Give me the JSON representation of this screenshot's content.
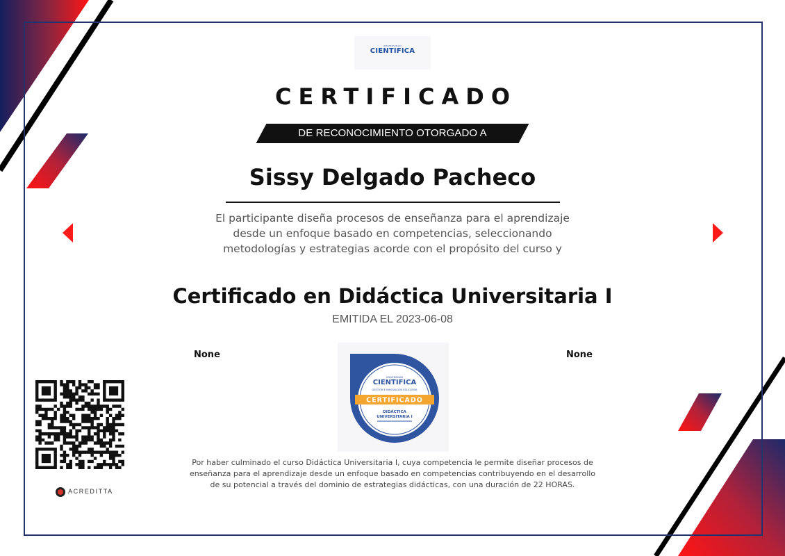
{
  "certificate": {
    "institution_logo": {
      "small_text": "UNIVERSIDAD",
      "name": "CIENTIFICA"
    },
    "title": "CERTIFICADO",
    "subtitle": "DE RECONOCIMIENTO OTORGADO A",
    "recipient_name": "Sissy Delgado Pacheco",
    "description": "El participante diseña procesos de enseñanza para el aprendizaje desde un enfoque basado en competencias, seleccionando metodologías y estrategias acorde con el propósito del curso y proponiendo una",
    "course_name": "Certificado en Didáctica Universitaria I",
    "issued_label": "EMITIDA EL 2023-06-08",
    "signature_left": "None",
    "signature_right": "None",
    "badge": {
      "small_text": "UNIVERSIDAD",
      "institution": "CIENTIFICA",
      "area": "GESTIÓN E INNOVACIÓN EDUCATIVA",
      "ribbon": "CERTIFICADO",
      "course_line1": "DIDÁCTICA",
      "course_line2": "UNIVERSITARIA I"
    },
    "verifier": "ACREDITTA",
    "footer_text": "Por haber culminado el curso Didáctica Universitaria I, cuya competencia le permite diseñar procesos de enseñanza para el aprendizaje desde un enfoque basado en competencias contribuyendo en el desarrollo de su potencial a través del dominio de estrategias didácticas, con una duración de 22 HORAS."
  },
  "colors": {
    "navy": "#1c2a6b",
    "red": "#ff1a1a",
    "frame": "#23336b",
    "badge_blue": "#2f54a0",
    "badge_orange": "#f3a530"
  },
  "icons": {
    "left_arrow": "triangle-left-icon",
    "right_arrow": "triangle-right-icon",
    "qr": "qr-code-icon"
  }
}
